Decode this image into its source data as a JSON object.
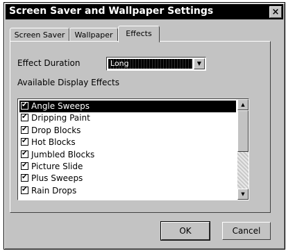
{
  "window": {
    "title": "Screen Saver and Wallpaper Settings",
    "close_glyph": "×"
  },
  "tabs": [
    {
      "label": "Screen Saver",
      "active": false
    },
    {
      "label": "Wallpaper",
      "active": false
    },
    {
      "label": "Effects",
      "active": true
    }
  ],
  "effects": {
    "duration_label": "Effect Duration",
    "duration_value": "Long",
    "available_label": "Available Display Effects",
    "items": [
      {
        "label": "Angle Sweeps",
        "checked": true,
        "selected": true
      },
      {
        "label": "Dripping Paint",
        "checked": true,
        "selected": false
      },
      {
        "label": "Drop Blocks",
        "checked": true,
        "selected": false
      },
      {
        "label": "Hot Blocks",
        "checked": true,
        "selected": false
      },
      {
        "label": "Jumbled Blocks",
        "checked": true,
        "selected": false
      },
      {
        "label": "Picture Slide",
        "checked": true,
        "selected": false
      },
      {
        "label": "Plus Sweeps",
        "checked": true,
        "selected": false
      },
      {
        "label": "Rain Drops",
        "checked": true,
        "selected": false
      }
    ]
  },
  "buttons": {
    "ok": "OK",
    "cancel": "Cancel"
  }
}
